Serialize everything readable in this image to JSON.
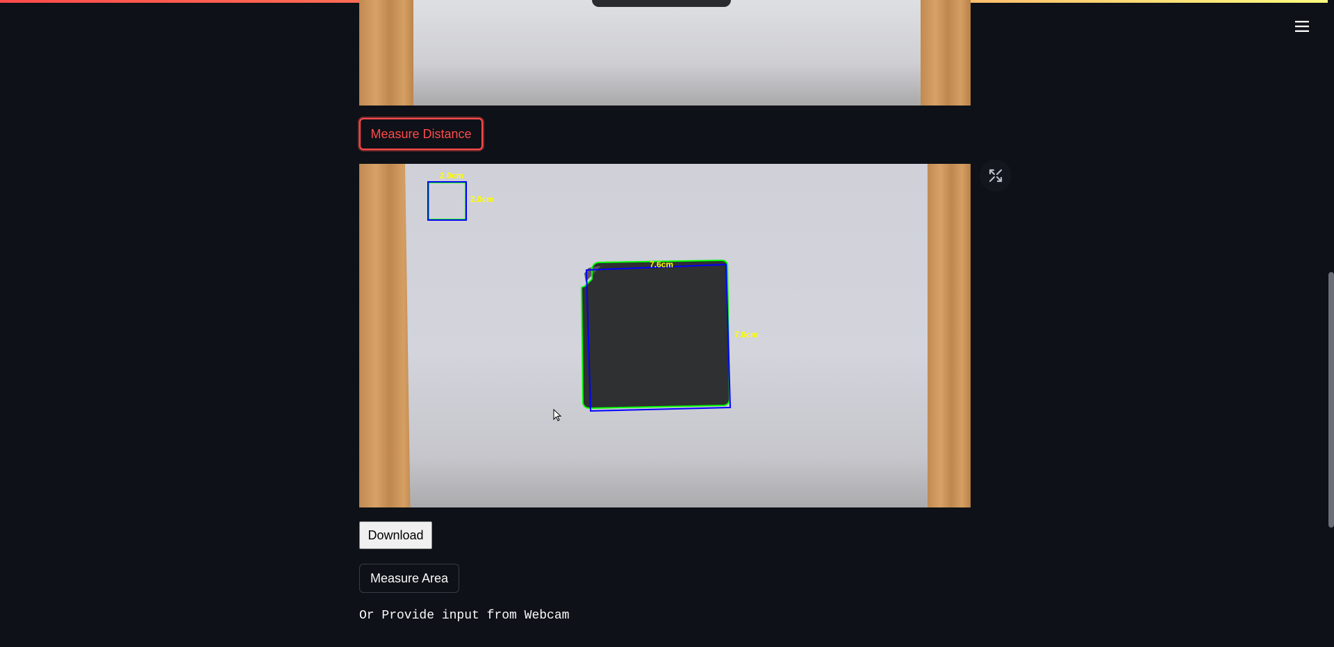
{
  "header": {
    "menu_icon": "hamburger-menu-icon"
  },
  "top_image": {
    "description_icon": "photo"
  },
  "buttons": {
    "measure_distance": "Measure Distance",
    "download": "Download",
    "measure_area": "Measure Area"
  },
  "result_image": {
    "reference_width": "2.0cm",
    "reference_height": "2.0cm",
    "object_width": "7.6cm",
    "object_height": "7.6cm",
    "fullscreen_icon": "fullscreen-icon"
  },
  "webcam_prompt": "Or Provide input from Webcam",
  "colors": {
    "background": "#0e1117",
    "accent": "#ff4b4b",
    "annotation_text": "#ffff00",
    "box_outline": "#0000ff",
    "contour": "#00ff00"
  }
}
